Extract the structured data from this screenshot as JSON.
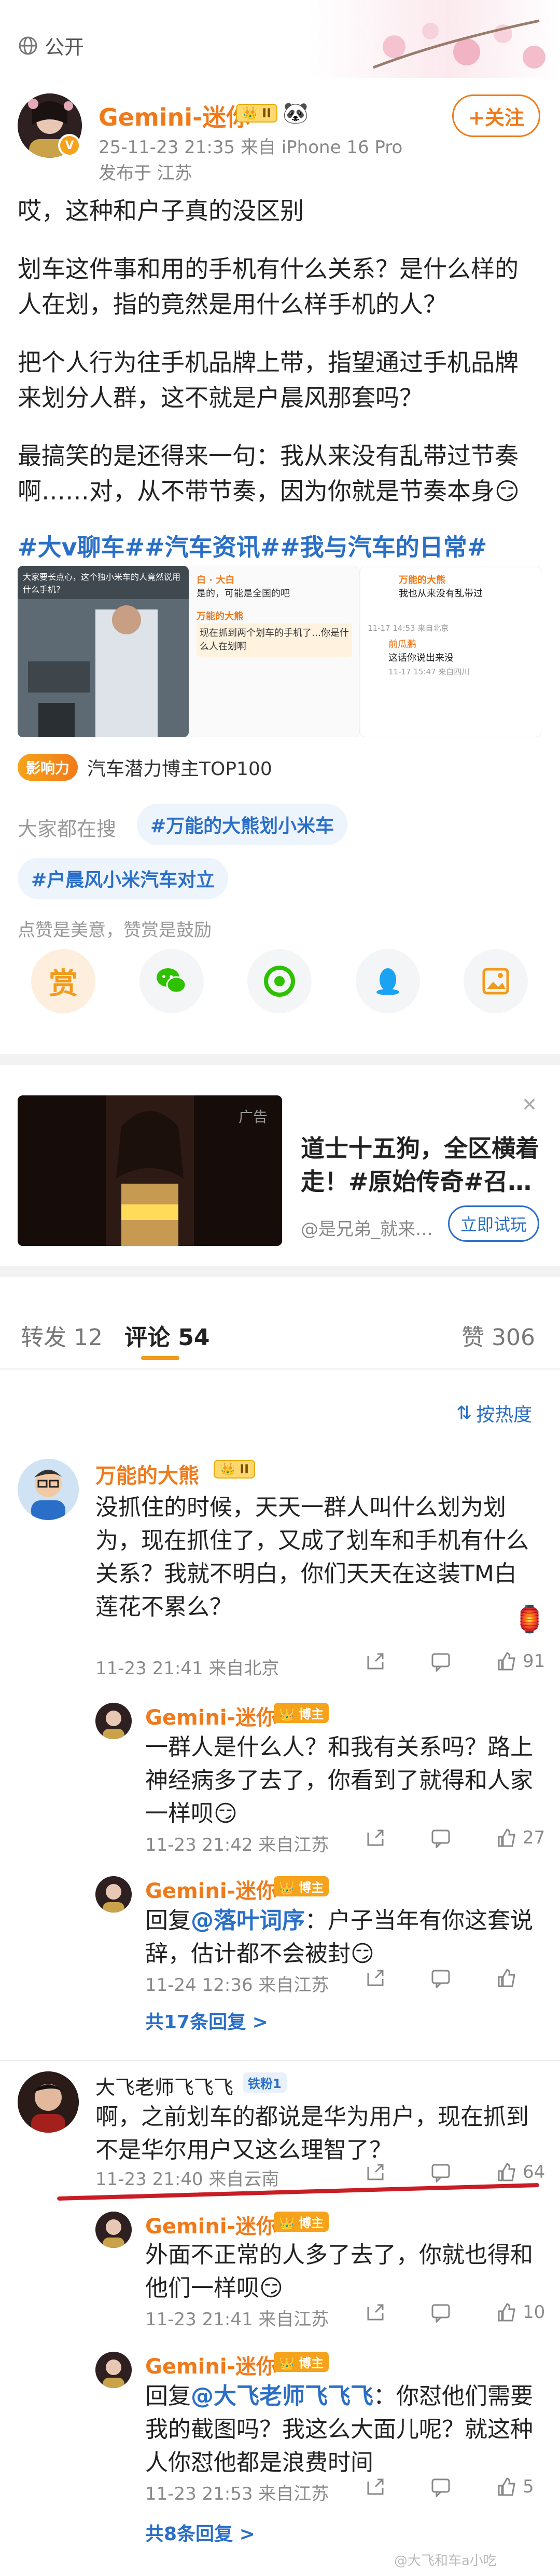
{
  "header": {
    "visibility_label": "公开"
  },
  "post": {
    "author": "Gemini-迷你",
    "level": "II",
    "follow_label": "+关注",
    "time_line": "25-11-23 21:35  来自 iPhone 16 Pro",
    "location_line": "发布于 江苏",
    "paragraphs": [
      "哎，这种和户子真的没区别",
      "划车这件事和用的手机有什么关系？是什么样的人在划，指的竟然是用什么样手机的人？",
      "把个人行为往手机品牌上带，指望通过手机品牌来划分人群，这不就是户晨风那套吗？",
      "最搞笑的是还得来一句：我从来没有乱带过节奏啊……对，从不带节奏，因为你就是节奏本身"
    ],
    "topics": "#大v聊车##汽车资讯##我与汽车的日常#",
    "influence_badge": "影响力",
    "influence_text": "汽车潜力博主TOP100",
    "search_label": "大家都在搜",
    "search_chips": [
      "#万能的大熊划小米车",
      "#户晨风小米汽车对立"
    ],
    "reward_text": "点赞是美意，赞赏是鼓励",
    "share_icons": [
      "reward-icon",
      "wechat-icon",
      "moments-icon",
      "qq-icon",
      "save-image-icon"
    ],
    "share_reward_char": "赏"
  },
  "thumb": {
    "caption": "大家要长点心，这个独小米车的人竟然说用什么手机？",
    "bubble_title": "白 · 大白",
    "bubble_text": "是的，可能是全国的吧",
    "bubble2_title": "万能的大熊",
    "bubble2_text": "现在抓到两个划车的手机了…你是什么人在划啊"
  },
  "thumb2": {
    "title": "万能的大熊",
    "text": "我也从来没有乱带过",
    "time": "11-17 14:53 来自北京",
    "sub_name": "前瓜鹏",
    "sub_text": "这话你说出来没",
    "sub_time": "11-17 15:47 来自四川"
  },
  "ad": {
    "label": "广告",
    "title": "道士十五狗，全区横着走！#原始传奇#召…",
    "source": "@是兄弟_就来…",
    "cta": "立即试玩"
  },
  "tabs": {
    "repost": "转发 12",
    "comments": "评论 54",
    "likes": "赞 306",
    "sort_label": "按热度"
  },
  "comments": [
    {
      "author": "万能的大熊",
      "badge": "II",
      "text": "没抓住的时候，天天一群人叫什么划为划为，现在抓住了，又成了划车和手机有什么关系？我就不明白，你们天天在这装TM白莲花不累么？",
      "meta": "11-23 21:41  来自北京",
      "likes": "91",
      "replies": [
        {
          "author": "Gemini-迷你",
          "tag": "博主",
          "text": "一群人是什么人？和我有关系吗？路上神经病多了去了，你看到了就得和人家一样呗",
          "meta": "11-23 21:42  来自江苏",
          "likes": "27"
        },
        {
          "author": "Gemini-迷你",
          "tag": "博主",
          "reply_prefix": "回复",
          "reply_to": "@落叶词序",
          "text": "：户子当年有你这套说辞，估计都不会被封",
          "meta": "11-24 12:36  来自江苏",
          "likes": ""
        }
      ],
      "more_replies": "共17条回复 >"
    },
    {
      "author": "大飞老师飞飞飞",
      "badge": "铁粉1",
      "text": "啊，之前划车的都说是华为用户，现在抓到不是华尔用户又这么理智了？",
      "meta": "11-23 21:40  来自云南",
      "likes": "64",
      "replies": [
        {
          "author": "Gemini-迷你",
          "tag": "博主",
          "text": "外面不正常的人多了去了，你就也得和他们一样呗",
          "meta": "11-23 21:41  来自江苏",
          "likes": "10"
        },
        {
          "author": "Gemini-迷你",
          "tag": "博主",
          "reply_prefix": "回复",
          "reply_to": "@大飞老师飞飞飞",
          "text": "：你怼他们需要我的截图吗？我这么大面儿呢？就这种人你怼他都是浪费时间",
          "meta": "11-23 21:53  来自江苏",
          "likes": "5"
        }
      ],
      "more_replies": "共8条回复 >"
    }
  ],
  "watermark": "@大飞和车a小吃"
}
